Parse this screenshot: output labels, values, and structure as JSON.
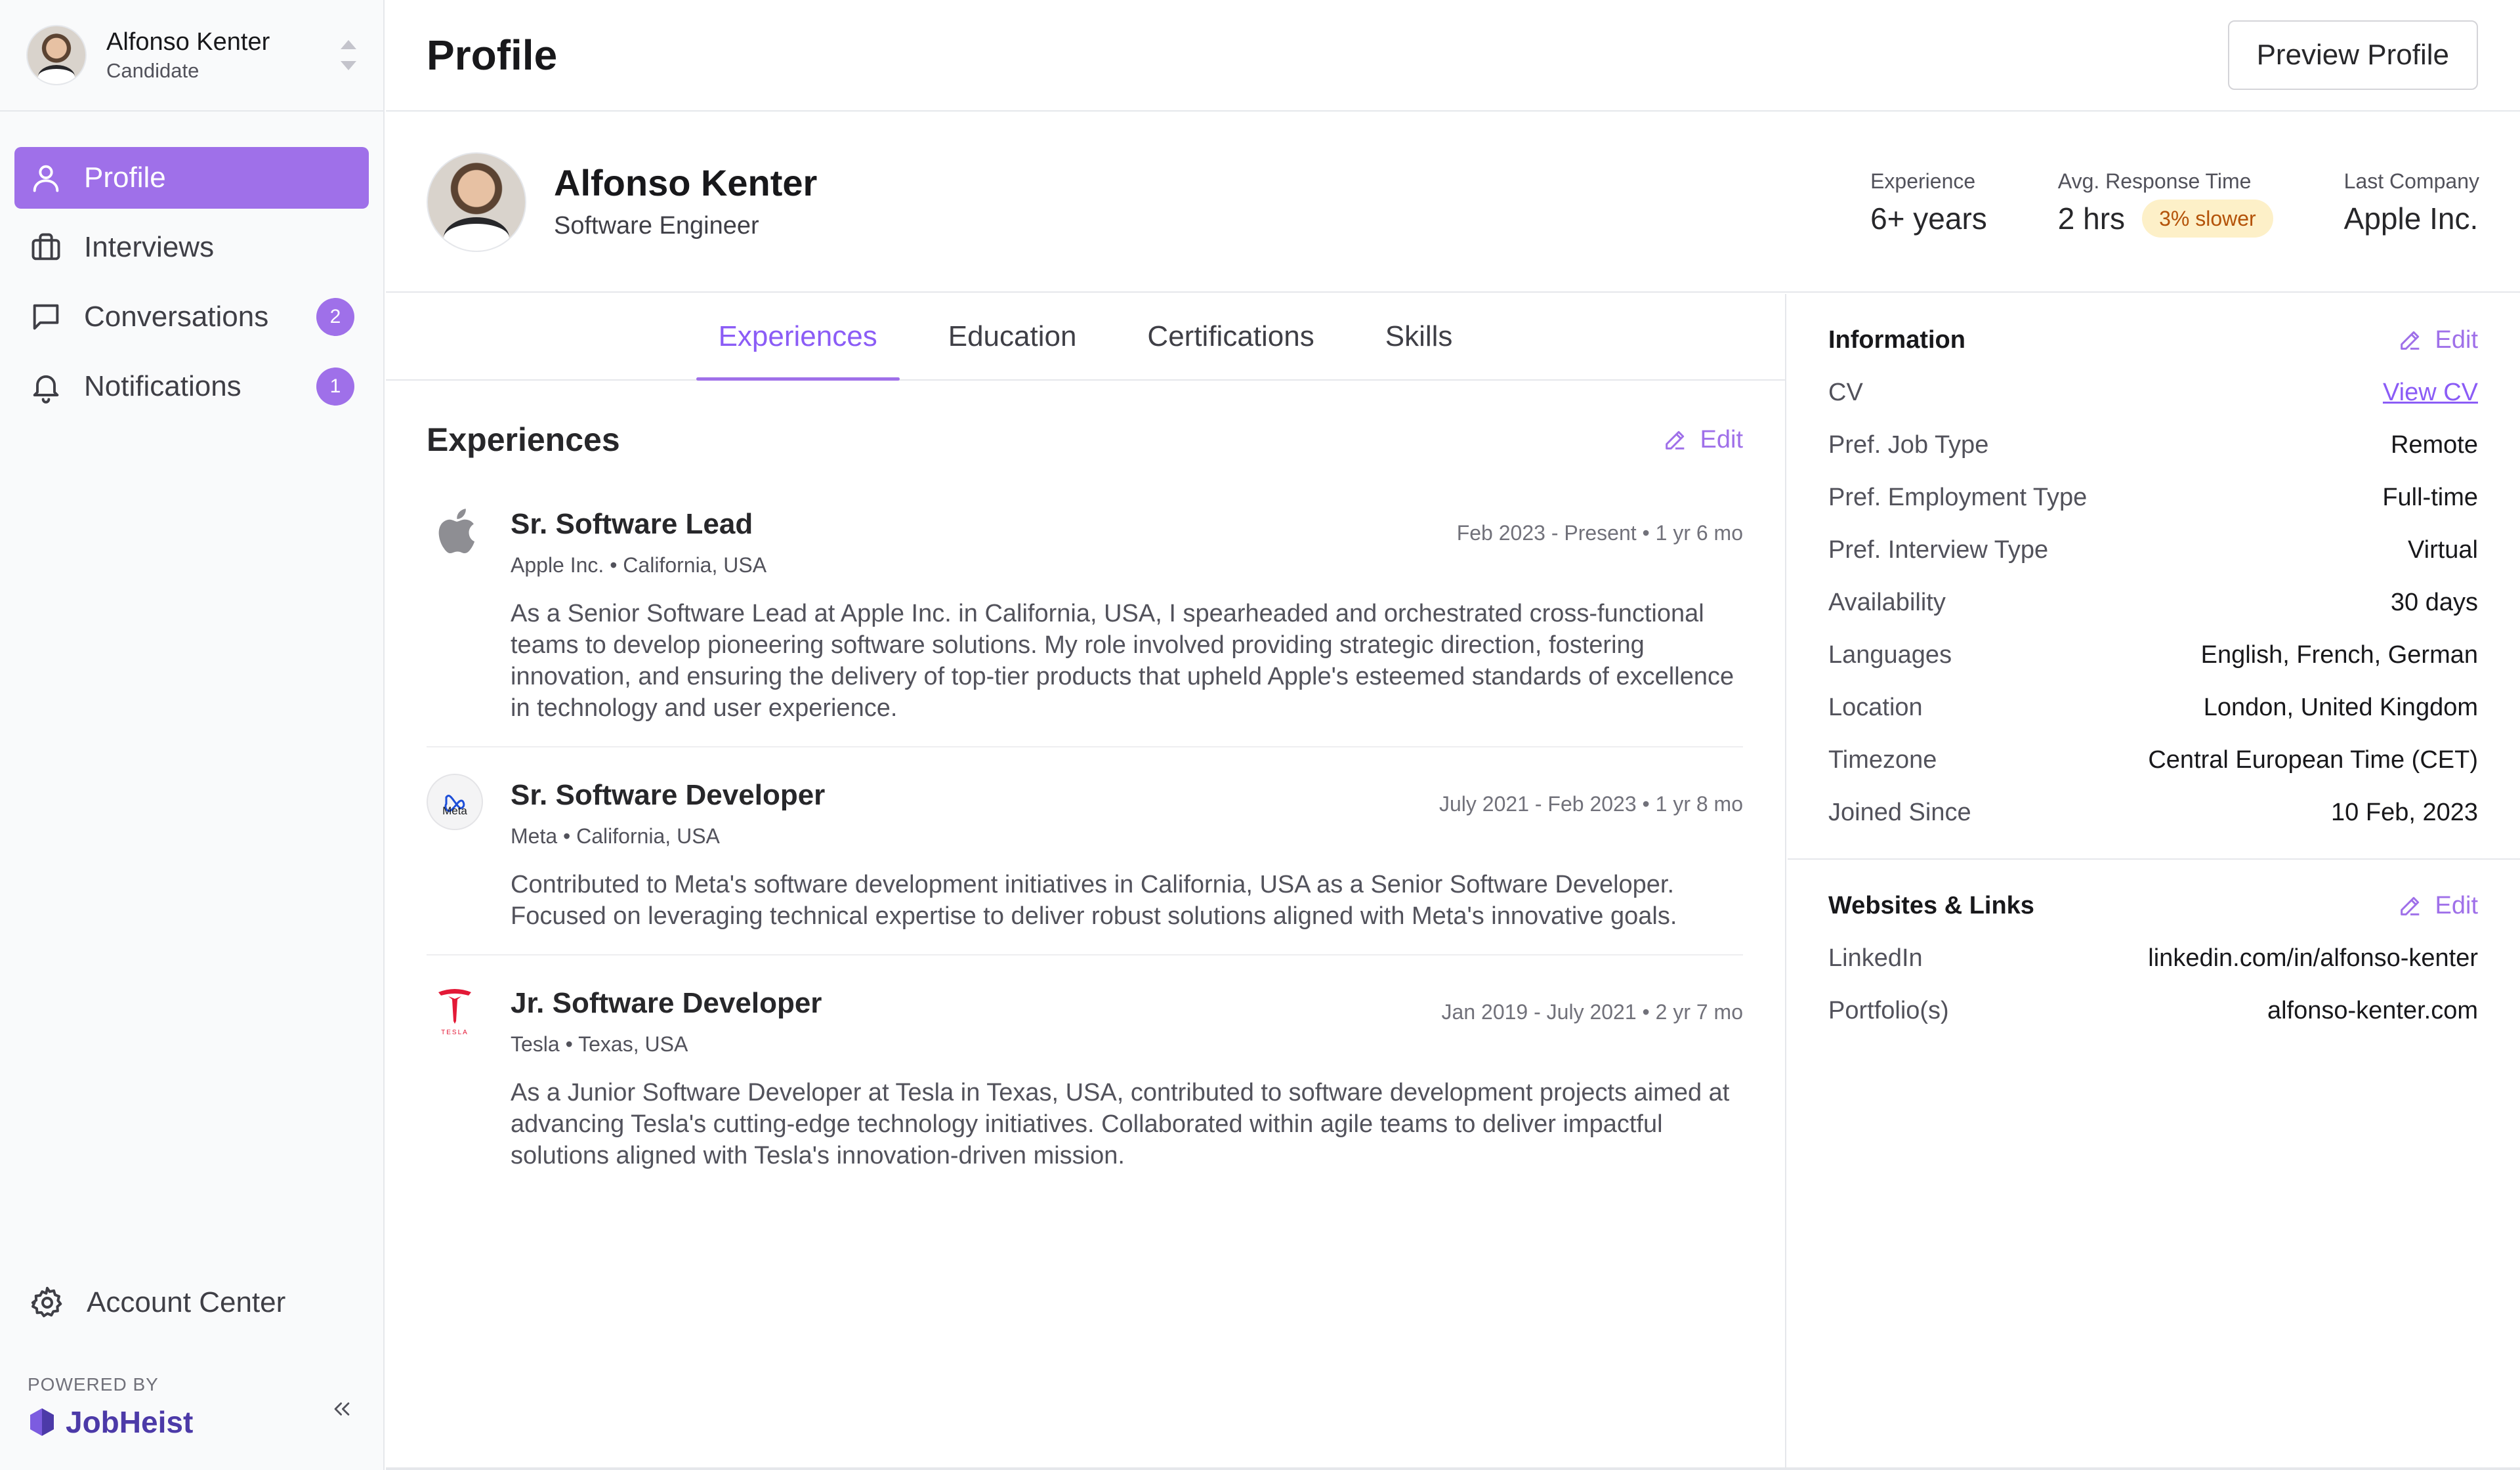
{
  "sidebar": {
    "user": {
      "name": "Alfonso Kenter",
      "role": "Candidate"
    },
    "nav": [
      {
        "label": "Profile",
        "icon": "user-icon",
        "active": true,
        "badge": ""
      },
      {
        "label": "Interviews",
        "icon": "briefcase-icon",
        "active": false,
        "badge": ""
      },
      {
        "label": "Conversations",
        "icon": "chat-icon",
        "active": false,
        "badge": "2"
      },
      {
        "label": "Notifications",
        "icon": "bell-icon",
        "active": false,
        "badge": "1"
      }
    ],
    "account_center": "Account Center",
    "powered_by": "POWERED BY",
    "brand": "JobHeist"
  },
  "header": {
    "title": "Profile",
    "preview_button": "Preview Profile"
  },
  "profile": {
    "name": "Alfonso Kenter",
    "title": "Software Engineer",
    "stats": {
      "experience": {
        "label": "Experience",
        "value": "6+ years"
      },
      "response": {
        "label": "Avg. Response Time",
        "value": "2 hrs",
        "badge": "3% slower"
      },
      "company": {
        "label": "Last Company",
        "value": "Apple Inc."
      }
    }
  },
  "tabs": [
    {
      "label": "Experiences",
      "active": true
    },
    {
      "label": "Education",
      "active": false
    },
    {
      "label": "Certifications",
      "active": false
    },
    {
      "label": "Skills",
      "active": false
    }
  ],
  "experiences": {
    "title": "Experiences",
    "edit": "Edit",
    "items": [
      {
        "logo": "apple-logo-icon",
        "role": "Sr. Software Lead",
        "company": "Apple Inc. • California, USA",
        "dates": "Feb 2023 - Present • 1 yr 6 mo",
        "description": "As a Senior Software Lead at Apple Inc. in California, USA, I spearheaded and orchestrated cross-functional teams to develop pioneering software solutions. My role involved providing strategic direction, fostering innovation, and ensuring the delivery of top-tier products that upheld Apple's esteemed standards of excellence in technology and user experience."
      },
      {
        "logo": "meta-logo-icon",
        "logo_text": "Meta",
        "role": "Sr. Software Developer",
        "company": "Meta • California, USA",
        "dates": "July 2021 - Feb 2023 • 1 yr 8 mo",
        "description": "Contributed to Meta's software development initiatives in California, USA as a Senior Software Developer. Focused on leveraging technical expertise to deliver robust solutions aligned with Meta's innovative goals."
      },
      {
        "logo": "tesla-logo-icon",
        "logo_text": "TESLA",
        "role": "Jr. Software Developer",
        "company": "Tesla • Texas, USA",
        "dates": "Jan 2019 - July 2021 • 2 yr 7 mo",
        "description": "As a Junior Software Developer at Tesla in Texas, USA, contributed to software development projects aimed at advancing Tesla's cutting-edge technology initiatives. Collaborated within agile teams to deliver impactful solutions aligned with Tesla's innovation-driven mission."
      }
    ]
  },
  "information": {
    "title": "Information",
    "edit": "Edit",
    "rows": [
      {
        "key": "CV",
        "value": "View CV",
        "link": true
      },
      {
        "key": "Pref. Job Type",
        "value": "Remote"
      },
      {
        "key": "Pref. Employment Type",
        "value": "Full-time"
      },
      {
        "key": "Pref. Interview Type",
        "value": "Virtual"
      },
      {
        "key": "Availability",
        "value": "30 days"
      },
      {
        "key": "Languages",
        "value": "English, French, German"
      },
      {
        "key": "Location",
        "value": "London, United Kingdom"
      },
      {
        "key": "Timezone",
        "value": "Central European Time (CET)"
      },
      {
        "key": "Joined Since",
        "value": "10 Feb, 2023"
      }
    ]
  },
  "links": {
    "title": "Websites & Links",
    "edit": "Edit",
    "rows": [
      {
        "key": "LinkedIn",
        "value": "linkedin.com/in/alfonso-kenter"
      },
      {
        "key": "Portfolio(s)",
        "value": "alfonso-kenter.com"
      }
    ]
  },
  "colors": {
    "accent": "#9f70e9",
    "badge_bg": "#fdf0c8",
    "badge_text": "#b45309"
  }
}
